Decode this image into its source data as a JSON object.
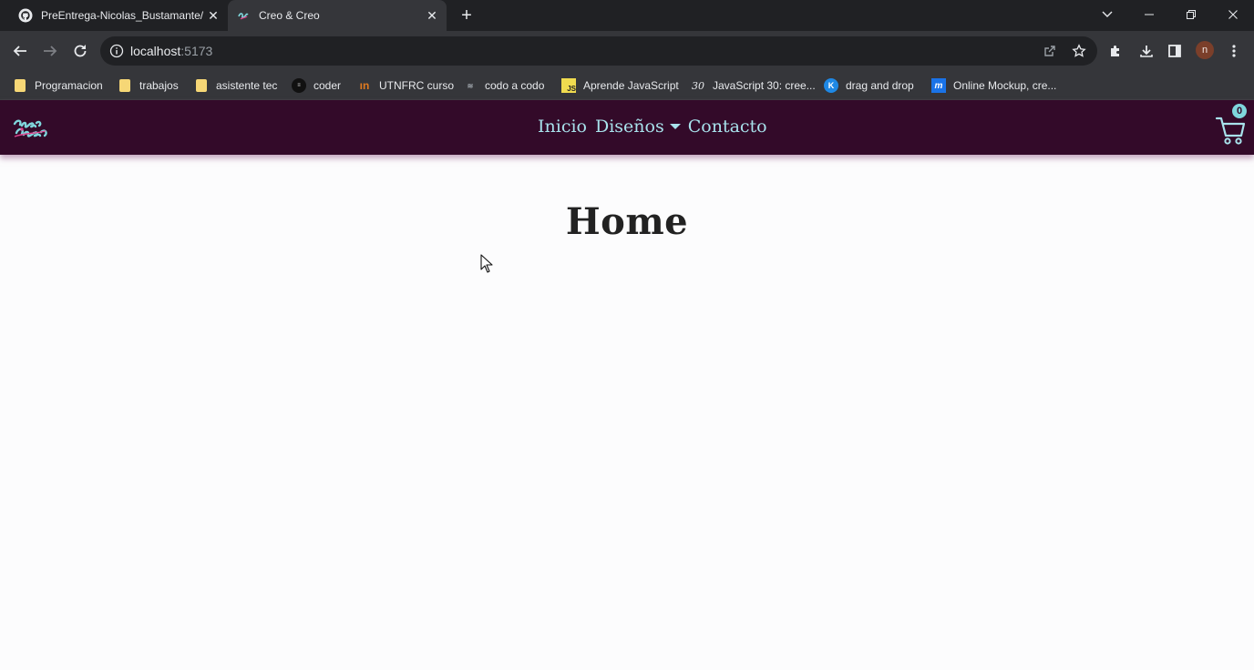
{
  "browser": {
    "tabs": [
      {
        "title": "PreEntrega-Nicolas_Bustamante/",
        "icon": "github-icon"
      },
      {
        "title": "Creo & Creo",
        "icon": "creo-favicon"
      }
    ],
    "url_host": "localhost",
    "url_port": ":5173",
    "avatar_initial": "n",
    "bookmarks": [
      {
        "label": "Programacion",
        "icon": "folder-icon"
      },
      {
        "label": "trabajos",
        "icon": "folder-icon"
      },
      {
        "label": "asistente tec",
        "icon": "folder-icon"
      },
      {
        "label": "coder",
        "icon": "coder-icon"
      },
      {
        "label": "UTNFRC curso",
        "icon": "utn-icon"
      },
      {
        "label": "codo a codo",
        "icon": "codo-icon"
      },
      {
        "label": "Aprende JavaScript",
        "icon": "js-icon"
      },
      {
        "label": "JavaScript 30: cree...",
        "icon": "js30-icon"
      },
      {
        "label": "drag and drop",
        "icon": "k-icon"
      },
      {
        "label": "Online Mockup, cre...",
        "icon": "m-icon"
      }
    ]
  },
  "site": {
    "nav": {
      "inicio": "Inicio",
      "disenos": "Diseños",
      "contacto": "Contacto"
    },
    "cart_count": "0",
    "heading": "Home"
  },
  "colors": {
    "nav_bg": "#330a29",
    "nav_link": "#a8e2ec",
    "badge": "#7fd6dc",
    "logo_pink": "#e0468f"
  }
}
